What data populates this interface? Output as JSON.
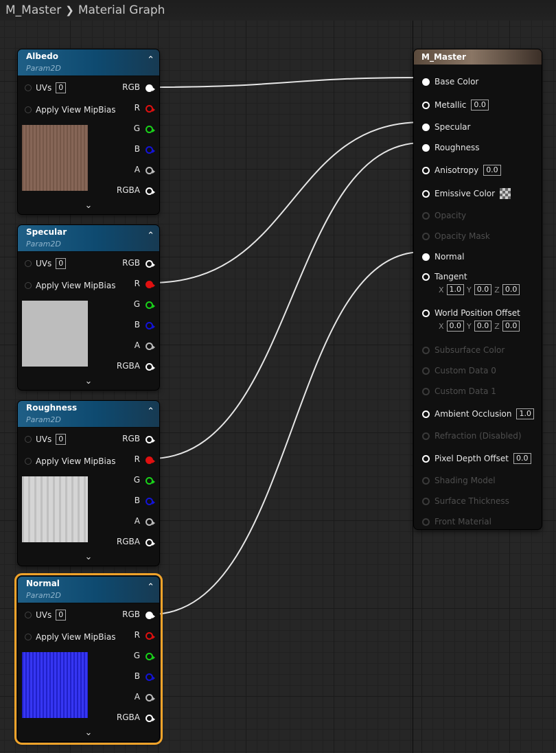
{
  "breadcrumb": {
    "root": "M_Master",
    "current": "Material Graph"
  },
  "nodes": [
    {
      "title": "Albedo",
      "subtitle": "Param2D",
      "uvs_label": "UVs",
      "uvs_value": "0",
      "mip_label": "Apply View MipBias",
      "outputs": [
        "RGB",
        "R",
        "G",
        "B",
        "A",
        "RGBA"
      ],
      "thumb_color": "#7f5e4e",
      "connected_output": "RGB"
    },
    {
      "title": "Specular",
      "subtitle": "Param2D",
      "uvs_label": "UVs",
      "uvs_value": "0",
      "mip_label": "Apply View MipBias",
      "outputs": [
        "RGB",
        "R",
        "G",
        "B",
        "A",
        "RGBA"
      ],
      "thumb_color": "#bdbdbd",
      "connected_output": "R"
    },
    {
      "title": "Roughness",
      "subtitle": "Param2D",
      "uvs_label": "UVs",
      "uvs_value": "0",
      "mip_label": "Apply View MipBias",
      "outputs": [
        "RGB",
        "R",
        "G",
        "B",
        "A",
        "RGBA"
      ],
      "thumb_color": "#cfcfcf",
      "connected_output": "R"
    },
    {
      "title": "Normal",
      "subtitle": "Param2D",
      "uvs_label": "UVs",
      "uvs_value": "0",
      "mip_label": "Apply View MipBias",
      "outputs": [
        "RGB",
        "R",
        "G",
        "B",
        "A",
        "RGBA"
      ],
      "thumb_color": "#2a2af0",
      "connected_output": "RGB",
      "selected": true
    }
  ],
  "master": {
    "title": "M_Master",
    "inputs": [
      {
        "label": "Base Color",
        "connected": true
      },
      {
        "label": "Metallic",
        "value": "0.0"
      },
      {
        "label": "Specular",
        "connected": true
      },
      {
        "label": "Roughness",
        "connected": true
      },
      {
        "label": "Anisotropy",
        "value": "0.0"
      },
      {
        "label": "Emissive Color",
        "swatch": "checker"
      },
      {
        "label": "Opacity",
        "disabled": true
      },
      {
        "label": "Opacity Mask",
        "disabled": true
      },
      {
        "label": "Normal",
        "connected": true
      },
      {
        "label": "Tangent",
        "vector": {
          "x": "1.0",
          "y": "0.0",
          "z": "0.0"
        }
      },
      {
        "label": "World Position Offset",
        "vector": {
          "x": "0.0",
          "y": "0.0",
          "z": "0.0"
        }
      },
      {
        "label": "Subsurface Color",
        "disabled": true
      },
      {
        "label": "Custom Data 0",
        "disabled": true
      },
      {
        "label": "Custom Data 1",
        "disabled": true
      },
      {
        "label": "Ambient Occlusion",
        "value": "1.0"
      },
      {
        "label": "Refraction (Disabled)",
        "disabled": true
      },
      {
        "label": "Pixel Depth Offset",
        "value": "0.0"
      },
      {
        "label": "Shading Model",
        "disabled": true
      },
      {
        "label": "Surface Thickness",
        "disabled": true
      },
      {
        "label": "Front Material",
        "disabled": true
      }
    ]
  },
  "colors": {
    "red": "#e01010",
    "green": "#1ad21a",
    "blue": "#1414d8",
    "selection": "#f0a32a"
  },
  "vector_labels": {
    "x": "X",
    "y": "Y",
    "z": "Z"
  }
}
